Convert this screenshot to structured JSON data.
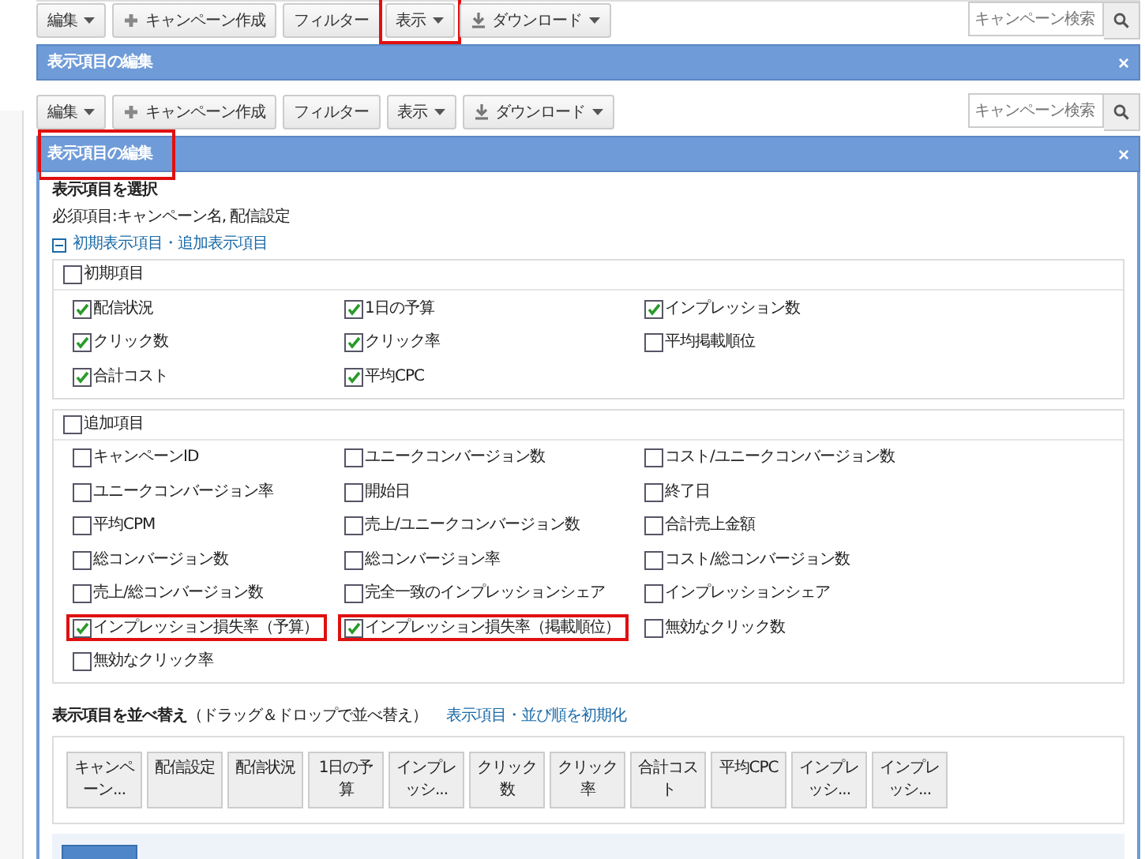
{
  "sections": [
    {
      "toolbar": {
        "buttons": [
          {
            "label": "編集",
            "kind": "dropdown",
            "highlighted": false
          },
          {
            "label": "キャンペーン作成",
            "kind": "add",
            "highlighted": false
          },
          {
            "label": "フィルター",
            "kind": "plain",
            "highlighted": false
          },
          {
            "label": "表示",
            "kind": "dropdown",
            "highlighted": true
          },
          {
            "label": "ダウンロード",
            "kind": "download",
            "highlighted": false
          }
        ],
        "search": {
          "placeholder": "キャンペーン検索"
        }
      },
      "header": {
        "title": "表示項目の編集",
        "close": "×",
        "highlighted": false
      }
    },
    {
      "toolbar": {
        "buttons": [
          {
            "label": "編集",
            "kind": "dropdown",
            "highlighted": false
          },
          {
            "label": "キャンペーン作成",
            "kind": "add",
            "highlighted": false
          },
          {
            "label": "フィルター",
            "kind": "plain",
            "highlighted": false
          },
          {
            "label": "表示",
            "kind": "dropdown",
            "highlighted": false
          },
          {
            "label": "ダウンロード",
            "kind": "download",
            "highlighted": false
          }
        ],
        "search": {
          "placeholder": "キャンペーン検索"
        }
      },
      "header": {
        "title": "表示項目の編集",
        "close": "×",
        "highlighted": true
      },
      "body": {
        "select_title": "表示項目を選択",
        "required_note": "必須項目:キャンペーン名, 配信設定",
        "toggle": {
          "label": "初期表示項目・追加表示項目",
          "expanded": true
        },
        "groups": [
          {
            "label": "初期項目",
            "checked": false,
            "items": [
              {
                "label": "配信状況",
                "checked": true,
                "highlighted": false
              },
              {
                "label": "1日の予算",
                "checked": true,
                "highlighted": false
              },
              {
                "label": "インプレッション数",
                "checked": true,
                "highlighted": false
              },
              {
                "label": "クリック数",
                "checked": true,
                "highlighted": false
              },
              {
                "label": "クリック率",
                "checked": true,
                "highlighted": false
              },
              {
                "label": "平均掲載順位",
                "checked": false,
                "highlighted": false
              },
              {
                "label": "合計コスト",
                "checked": true,
                "highlighted": false
              },
              {
                "label": "平均CPC",
                "checked": true,
                "highlighted": false
              }
            ]
          },
          {
            "label": "追加項目",
            "checked": false,
            "items": [
              {
                "label": "キャンペーンID",
                "checked": false,
                "highlighted": false
              },
              {
                "label": "ユニークコンバージョン数",
                "checked": false,
                "highlighted": false
              },
              {
                "label": "コスト/ユニークコンバージョン数",
                "checked": false,
                "highlighted": false
              },
              {
                "label": "ユニークコンバージョン率",
                "checked": false,
                "highlighted": false
              },
              {
                "label": "開始日",
                "checked": false,
                "highlighted": false
              },
              {
                "label": "終了日",
                "checked": false,
                "highlighted": false
              },
              {
                "label": "平均CPM",
                "checked": false,
                "highlighted": false
              },
              {
                "label": "売上/ユニークコンバージョン数",
                "checked": false,
                "highlighted": false
              },
              {
                "label": "合計売上金額",
                "checked": false,
                "highlighted": false
              },
              {
                "label": "総コンバージョン数",
                "checked": false,
                "highlighted": false
              },
              {
                "label": "総コンバージョン率",
                "checked": false,
                "highlighted": false
              },
              {
                "label": "コスト/総コンバージョン数",
                "checked": false,
                "highlighted": false
              },
              {
                "label": "売上/総コンバージョン数",
                "checked": false,
                "highlighted": false
              },
              {
                "label": "完全一致のインプレッションシェア",
                "checked": false,
                "highlighted": false
              },
              {
                "label": "インプレッションシェア",
                "checked": false,
                "highlighted": false
              },
              {
                "label": "インプレッション損失率（予算）",
                "checked": true,
                "highlighted": true
              },
              {
                "label": "インプレッション損失率（掲載順位）",
                "checked": true,
                "highlighted": true
              },
              {
                "label": "無効なクリック数",
                "checked": false,
                "highlighted": false
              },
              {
                "label": "無効なクリック率",
                "checked": false,
                "highlighted": false
              }
            ]
          }
        ],
        "sort_title": "**表示項目を並べ替え**（ドラッグ＆ドロップで並べ替え）",
        "reset_link": "表示項目・並び順を初期化",
        "chips": [
          "キャンペーン...",
          "配信設定",
          "配信状況",
          "1日の予算",
          "インプレッシ...",
          "クリック数",
          "クリック率",
          "合計コスト",
          "平均CPC",
          "インプレッシ...",
          "インプレッシ..."
        ]
      }
    }
  ]
}
